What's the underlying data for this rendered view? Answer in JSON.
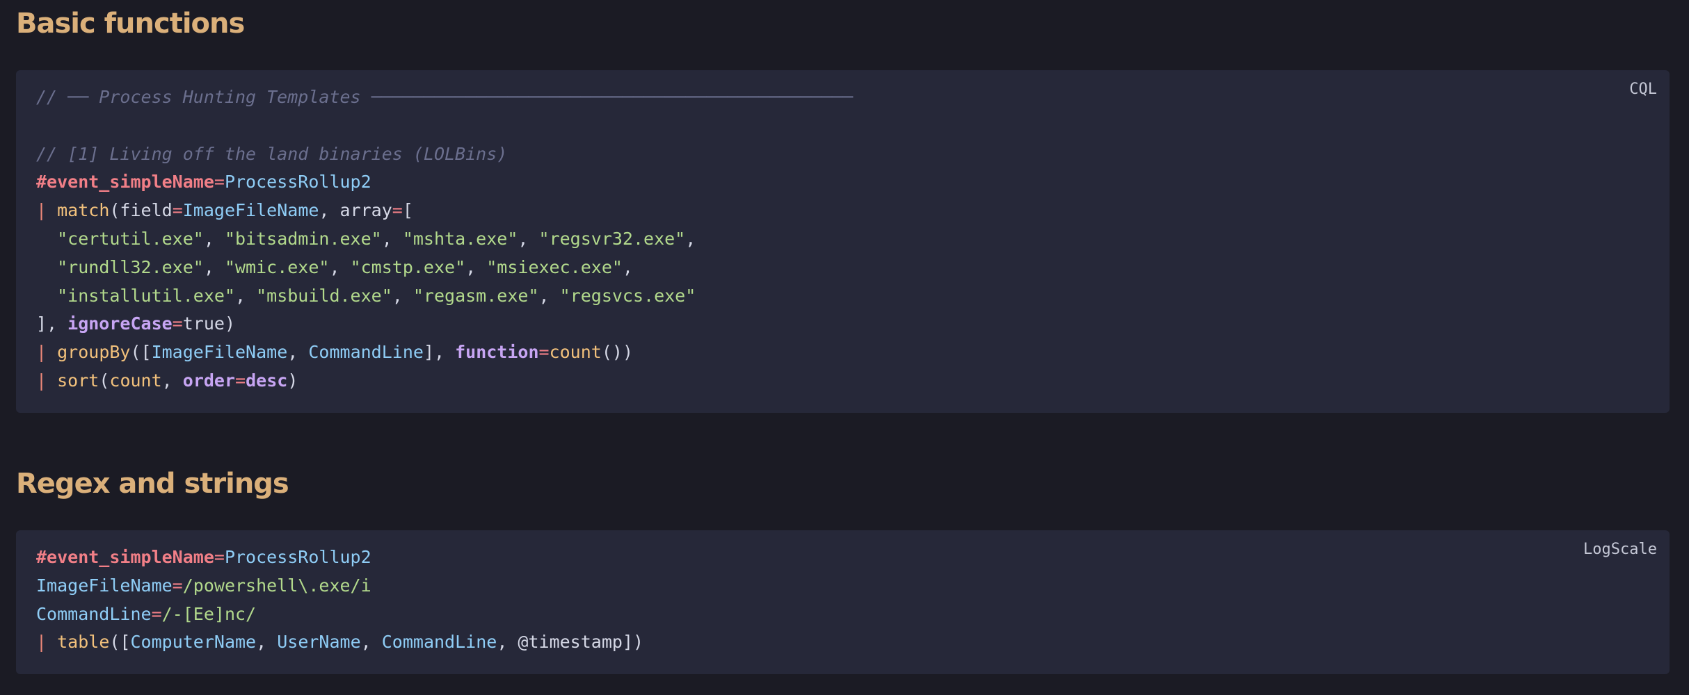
{
  "sections": [
    {
      "heading": "Basic functions",
      "language": "CQL",
      "lines": [
        [
          {
            "t": "// ── Process Hunting Templates ──────────────────────────────────────────────",
            "c": "cm"
          }
        ],
        [],
        [
          {
            "t": "// [1] Living off the land binaries (LOLBins)",
            "c": "cm"
          }
        ],
        [
          {
            "t": "#event_simpleName",
            "c": "tag"
          },
          {
            "t": "=",
            "c": "op"
          },
          {
            "t": "ProcessRollup2",
            "c": "id"
          }
        ],
        [
          {
            "t": "| ",
            "c": "pipe"
          },
          {
            "t": "match",
            "c": "fn"
          },
          {
            "t": "(field",
            "c": "pl"
          },
          {
            "t": "=",
            "c": "op"
          },
          {
            "t": "ImageFileName",
            "c": "id"
          },
          {
            "t": ", array",
            "c": "pl"
          },
          {
            "t": "=",
            "c": "op"
          },
          {
            "t": "[",
            "c": "pl"
          }
        ],
        [
          {
            "t": "  ",
            "c": "pl"
          },
          {
            "t": "\"certutil.exe\"",
            "c": "str"
          },
          {
            "t": ", ",
            "c": "pl"
          },
          {
            "t": "\"bitsadmin.exe\"",
            "c": "str"
          },
          {
            "t": ", ",
            "c": "pl"
          },
          {
            "t": "\"mshta.exe\"",
            "c": "str"
          },
          {
            "t": ", ",
            "c": "pl"
          },
          {
            "t": "\"regsvr32.exe\"",
            "c": "str"
          },
          {
            "t": ",",
            "c": "pl"
          }
        ],
        [
          {
            "t": "  ",
            "c": "pl"
          },
          {
            "t": "\"rundll32.exe\"",
            "c": "str"
          },
          {
            "t": ", ",
            "c": "pl"
          },
          {
            "t": "\"wmic.exe\"",
            "c": "str"
          },
          {
            "t": ", ",
            "c": "pl"
          },
          {
            "t": "\"cmstp.exe\"",
            "c": "str"
          },
          {
            "t": ", ",
            "c": "pl"
          },
          {
            "t": "\"msiexec.exe\"",
            "c": "str"
          },
          {
            "t": ",",
            "c": "pl"
          }
        ],
        [
          {
            "t": "  ",
            "c": "pl"
          },
          {
            "t": "\"installutil.exe\"",
            "c": "str"
          },
          {
            "t": ", ",
            "c": "pl"
          },
          {
            "t": "\"msbuild.exe\"",
            "c": "str"
          },
          {
            "t": ", ",
            "c": "pl"
          },
          {
            "t": "\"regasm.exe\"",
            "c": "str"
          },
          {
            "t": ", ",
            "c": "pl"
          },
          {
            "t": "\"regsvcs.exe\"",
            "c": "str"
          }
        ],
        [
          {
            "t": "], ",
            "c": "pl"
          },
          {
            "t": "ignoreCase",
            "c": "kw"
          },
          {
            "t": "=",
            "c": "op"
          },
          {
            "t": "true)",
            "c": "pl"
          }
        ],
        [
          {
            "t": "| ",
            "c": "pipe"
          },
          {
            "t": "groupBy",
            "c": "fn"
          },
          {
            "t": "([",
            "c": "pl"
          },
          {
            "t": "ImageFileName",
            "c": "id"
          },
          {
            "t": ", ",
            "c": "pl"
          },
          {
            "t": "CommandLine",
            "c": "id"
          },
          {
            "t": "], ",
            "c": "pl"
          },
          {
            "t": "function",
            "c": "kw"
          },
          {
            "t": "=",
            "c": "op"
          },
          {
            "t": "count",
            "c": "fn"
          },
          {
            "t": "())",
            "c": "pl"
          }
        ],
        [
          {
            "t": "| ",
            "c": "pipe"
          },
          {
            "t": "sort",
            "c": "fn"
          },
          {
            "t": "(",
            "c": "pl"
          },
          {
            "t": "count",
            "c": "fn"
          },
          {
            "t": ", ",
            "c": "pl"
          },
          {
            "t": "order",
            "c": "kw"
          },
          {
            "t": "=",
            "c": "op"
          },
          {
            "t": "desc",
            "c": "kw"
          },
          {
            "t": ")",
            "c": "pl"
          }
        ]
      ]
    },
    {
      "heading": "Regex and strings",
      "language": "LogScale",
      "lines": [
        [
          {
            "t": "#event_simpleName",
            "c": "tag"
          },
          {
            "t": "=",
            "c": "op"
          },
          {
            "t": "ProcessRollup2",
            "c": "id"
          }
        ],
        [
          {
            "t": "ImageFileName",
            "c": "id"
          },
          {
            "t": "=",
            "c": "op"
          },
          {
            "t": "/powershell\\.exe/i",
            "c": "str"
          }
        ],
        [
          {
            "t": "CommandLine",
            "c": "id"
          },
          {
            "t": "=",
            "c": "op"
          },
          {
            "t": "/-[Ee]nc/",
            "c": "str"
          }
        ],
        [
          {
            "t": "| ",
            "c": "pipe"
          },
          {
            "t": "table",
            "c": "fn"
          },
          {
            "t": "([",
            "c": "pl"
          },
          {
            "t": "ComputerName",
            "c": "id"
          },
          {
            "t": ", ",
            "c": "pl"
          },
          {
            "t": "UserName",
            "c": "id"
          },
          {
            "t": ", ",
            "c": "pl"
          },
          {
            "t": "CommandLine",
            "c": "id"
          },
          {
            "t": ", @timestamp])",
            "c": "pl"
          }
        ]
      ]
    }
  ]
}
